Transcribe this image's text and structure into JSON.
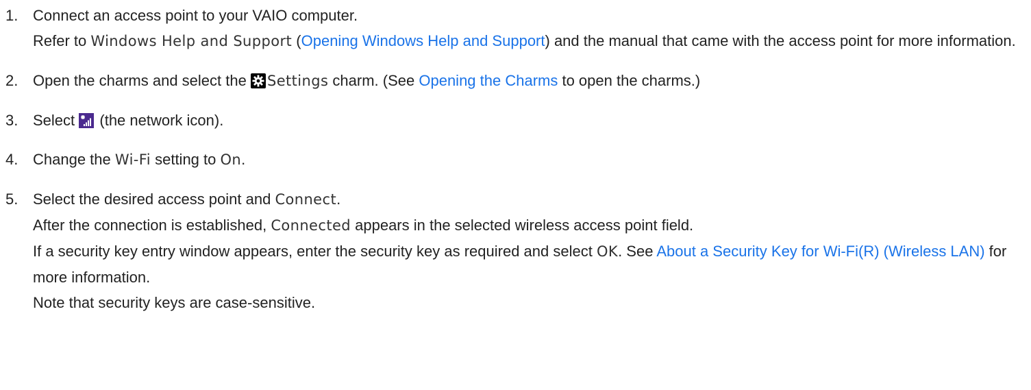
{
  "steps": [
    {
      "number": "1.",
      "line1": "Connect an access point to your VAIO computer.",
      "p_refer": "Refer to ",
      "ui_help": "Windows Help and Support",
      "p_open_paren": " (",
      "link_help": "Opening Windows Help and Support",
      "p_after_link": ") and the manual that came with the access point for more information."
    },
    {
      "number": "2.",
      "p_open": "Open the charms and select the ",
      "icon": "settings-gear-icon",
      "ui_settings": "Settings",
      "p_charm": " charm. (See ",
      "link_charms": "Opening the Charms",
      "p_end": " to open the charms.)"
    },
    {
      "number": "3.",
      "p_select": "Select ",
      "icon": "network-signal-icon",
      "p_end": " (the network icon)."
    },
    {
      "number": "4.",
      "p_change": "Change the ",
      "ui_wifi": "Wi-Fi",
      "p_setting": " setting to ",
      "ui_on": "On",
      "p_end": "."
    },
    {
      "number": "5.",
      "p_select": "Select the desired access point and ",
      "ui_connect": "Connect",
      "p_dot": ".",
      "p_after_conn": "After the connection is established, ",
      "ui_connected": "Connected",
      "p_appears": " appears in the selected wireless access point field.",
      "p_if": "If a security key entry window appears, enter the security key as required and select ",
      "ui_ok": "OK",
      "p_see": ". See ",
      "link_security": "About a Security Key for Wi-Fi(R) (Wireless LAN)",
      "p_more": " for more information.",
      "p_note": "Note that security keys are case-sensitive."
    }
  ],
  "colors": {
    "text": "#222222",
    "link": "#1a73e8",
    "icon_bg": "#000000",
    "network_icon_bg": "#4b2a8f"
  }
}
